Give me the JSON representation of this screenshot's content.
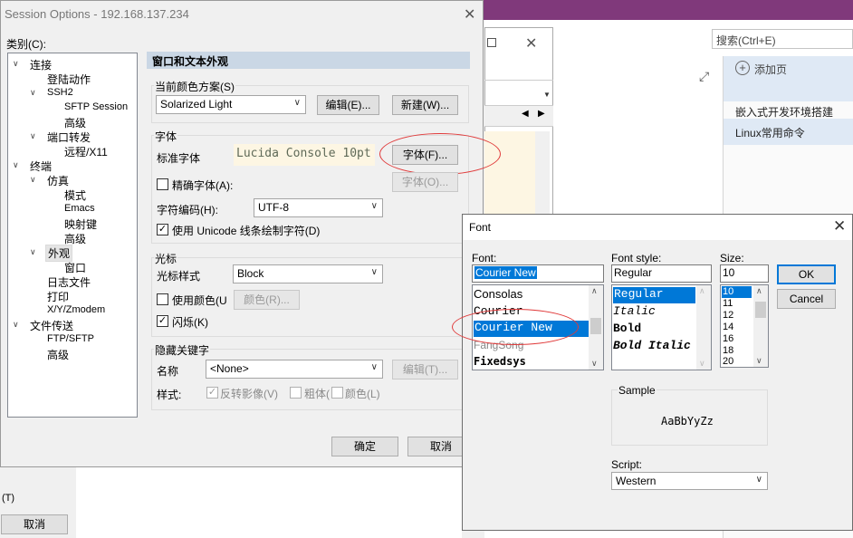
{
  "background_app": {
    "search_placeholder": "搜索(Ctrl+E)",
    "add_page": "添加页",
    "pages": [
      "嵌入式开发环境搭建",
      "Linux常用命令"
    ],
    "shortcut_fragment": "(T)",
    "cancel_label": "取消"
  },
  "session_options": {
    "title": "Session Options - 192.168.137.234",
    "category_label": "类别(C):",
    "tree": {
      "connection": "连接",
      "login_actions": "登陆动作",
      "ssh2": "SSH2",
      "sftp_session": "SFTP Session",
      "advanced1": "高级",
      "port_forwarding": "端口转发",
      "remote_x11": "远程/X11",
      "terminal": "终端",
      "emulation": "仿真",
      "modes": "模式",
      "emacs": "Emacs",
      "mapped_keys": "映射键",
      "advanced2": "高级",
      "appearance": "外观",
      "window": "窗口",
      "log_file": "日志文件",
      "printing": "打印",
      "xyzmodem": "X/Y/Zmodem",
      "file_transfer": "文件传送",
      "ftp_sftp": "FTP/SFTP",
      "advanced3": "高级"
    },
    "section_title": "窗口和文本外观",
    "color_scheme": {
      "label": "当前颜色方案(S)",
      "value": "Solarized Light",
      "edit_button": "编辑(E)...",
      "new_button": "新建(W)..."
    },
    "fonts": {
      "label": "字体",
      "normal_font_label": "标准字体",
      "normal_font_preview": "Lucida Console 10pt",
      "font_button": "字体(F)...",
      "precise_font_label": "精确字体(A):",
      "precise_font_button": "字体(O)...",
      "charset_label": "字符编码(H):",
      "charset_value": "UTF-8",
      "unicode_line_label": "使用 Unicode 线条绘制字符(D)",
      "unicode_line_checked": true
    },
    "cursor": {
      "label": "光标",
      "style_label": "光标样式",
      "style_value": "Block",
      "use_color_label": "使用颜色(U",
      "color_button": "颜色(R)...",
      "blink_label": "闪烁(K)",
      "blink_checked": true
    },
    "hidden_keywords": {
      "label": "隐藏关键字",
      "name_label": "名称",
      "name_value": "<None>",
      "edit_button": "编辑(T)...",
      "style_label": "样式:",
      "reverse_video": "反转影像(V)",
      "bold": "粗体(",
      "color": "颜色(L)"
    },
    "ok_button": "确定",
    "cancel_button": "取消"
  },
  "font_dialog": {
    "title": "Font",
    "font_label": "Font:",
    "font_value": "Courier New",
    "fonts": [
      "Consolas",
      "Courier",
      "Courier New",
      "FangSong",
      "Fixedsys"
    ],
    "style_label": "Font style:",
    "style_value": "Regular",
    "styles": [
      "Regular",
      "Italic",
      "Bold",
      "Bold Italic"
    ],
    "size_label": "Size:",
    "size_value": "10",
    "sizes": [
      "10",
      "11",
      "12",
      "14",
      "16",
      "18",
      "20"
    ],
    "ok_button": "OK",
    "cancel_button": "Cancel",
    "sample_label": "Sample",
    "sample_text": "AaBbYyZz",
    "script_label": "Script:",
    "script_value": "Western"
  },
  "colors": {
    "selection_blue": "#0078d7",
    "header_blue": "#cad7e5",
    "font_preview_bg": "#fdf6e3",
    "annotation_red": "#e03a3a",
    "app_purple": "#80397b"
  }
}
